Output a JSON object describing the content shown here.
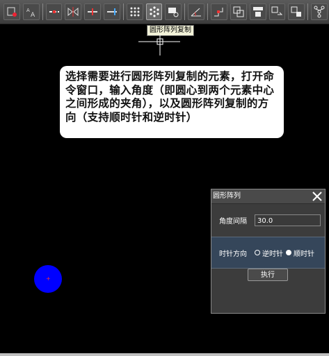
{
  "toolbar": {
    "tooltip": "圆形阵列复制",
    "buttons": [
      "record-icon",
      "text-size-icon",
      "dash-line-icon",
      "mirror-icon",
      "align-left-icon",
      "align-right-icon",
      "rect-array-icon",
      "circular-array-icon",
      "stamp-icon",
      "angle-icon",
      "step-icon",
      "overlap-icon",
      "table-icon",
      "rotate-copy-icon",
      "move-icon",
      "tree-icon"
    ],
    "active": "circular-array-icon"
  },
  "callout": {
    "text": "选择需要进行圆形阵列复制的元素，打开命令窗口，输入角度（即圆心到两个元素中心之间形成的夹角），以及圆形阵列复制的方向（支持顺时针和逆时针）"
  },
  "canvas": {
    "circle_color": "#0000ff",
    "center_mark": "+"
  },
  "panel": {
    "title": "圆形阵列",
    "angle_label": "角度间隔",
    "angle_value": "30.0",
    "direction_label": "时针方向",
    "ccw_label": "逆时针",
    "cw_label": "顺时针",
    "selected": "cw",
    "execute_label": "执行"
  },
  "colors": {
    "background": "#000000",
    "panel": "#3c3c3c",
    "direction_row": "#35465a"
  }
}
